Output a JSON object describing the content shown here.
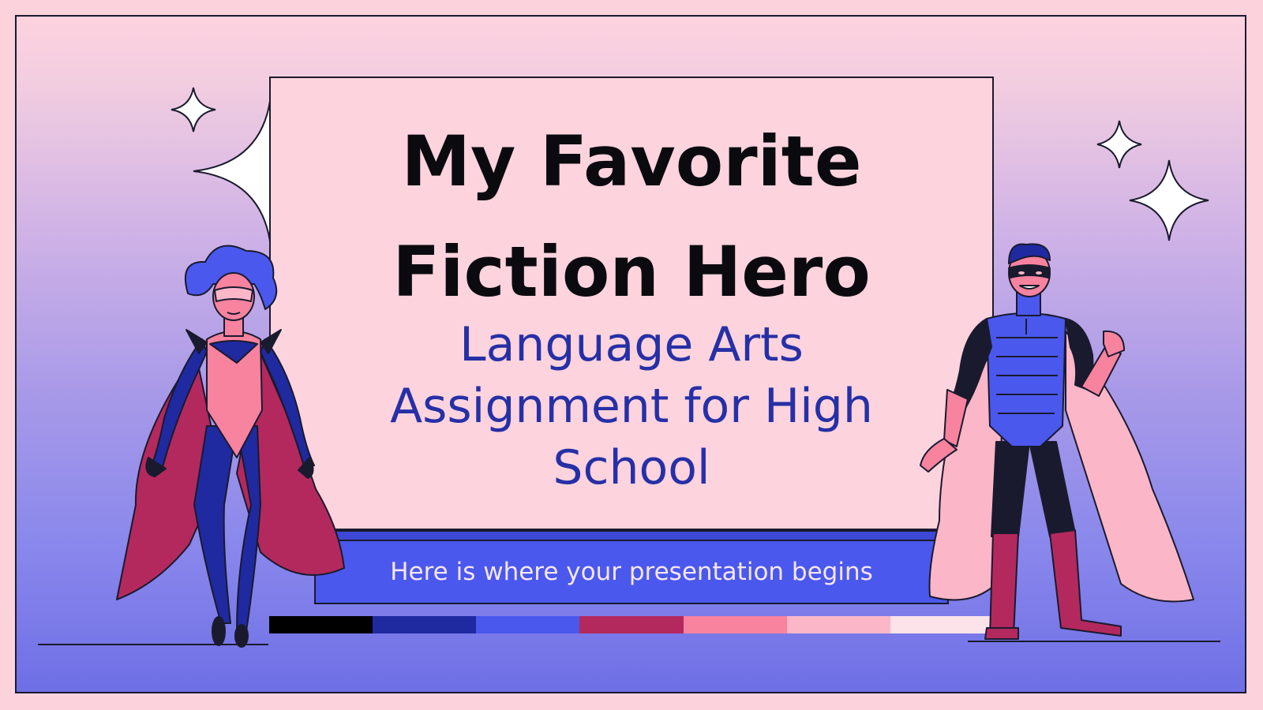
{
  "slide": {
    "title_line1": "My Favorite",
    "title_line2": "Fiction Hero",
    "subtitle_line1": "Language Arts",
    "subtitle_line2": "Assignment for High",
    "subtitle_line3": "School",
    "tagline": "Here is where your presentation begins"
  },
  "palette": [
    "#000000",
    "#1f2aa0",
    "#4a58ee",
    "#b3295e",
    "#f8839f",
    "#fbb6c8",
    "#fce3ea"
  ],
  "colors": {
    "background": "#fcd3dd",
    "card": "#fdd3de",
    "title": "#0b0b0f",
    "subtitle": "#2630a6",
    "banner": "#4a58ee",
    "banner_text": "#f5e6f0"
  },
  "illustrations": {
    "left": "female-superhero-illustration",
    "right": "male-superhero-illustration",
    "stars": "sparkle-star-icon"
  }
}
